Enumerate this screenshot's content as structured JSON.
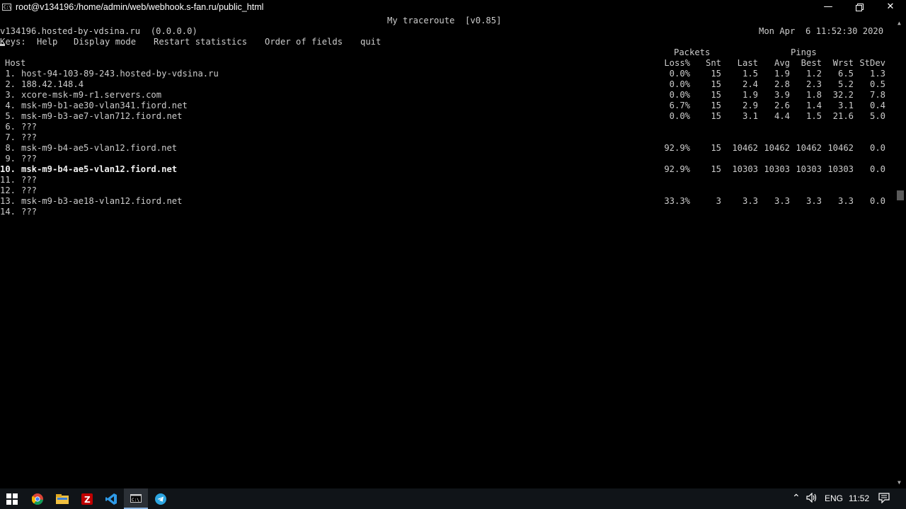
{
  "window": {
    "title": "root@v134196:/home/admin/web/webhook.s-fan.ru/public_html",
    "icon_glyph": "C:\\",
    "controls": [
      "minimize-icon",
      "restore-icon",
      "close-icon"
    ]
  },
  "terminal": {
    "app_title": "My traceroute  [v0.85]",
    "host_line": "v134196.hosted-by-vdsina.ru  (0.0.0.0)",
    "datetime": "Mon Apr  6 11:52:30 2020",
    "keys_label": "Keys:",
    "keys": [
      "Help",
      "Display mode",
      "Restart statistics",
      "Order of fields",
      "quit"
    ],
    "group_headers": {
      "packets": "Packets",
      "pings": "Pings"
    },
    "columns": {
      "host": "Host",
      "loss": "Loss%",
      "snt": "Snt",
      "last": "Last",
      "avg": "Avg",
      "best": "Best",
      "wrst": "Wrst",
      "stdev": "StDev"
    },
    "hops": [
      {
        "n": " 1.",
        "host": "host-94-103-89-243.hosted-by-vdsina.ru",
        "loss": "0.0%",
        "snt": "15",
        "last": "1.5",
        "avg": "1.9",
        "best": "1.2",
        "wrst": "6.5",
        "stdev": "1.3"
      },
      {
        "n": " 2.",
        "host": "188.42.148.4",
        "loss": "0.0%",
        "snt": "15",
        "last": "2.4",
        "avg": "2.8",
        "best": "2.3",
        "wrst": "5.2",
        "stdev": "0.5"
      },
      {
        "n": " 3.",
        "host": "xcore-msk-m9-r1.servers.com",
        "loss": "0.0%",
        "snt": "15",
        "last": "1.9",
        "avg": "3.9",
        "best": "1.8",
        "wrst": "32.2",
        "stdev": "7.8"
      },
      {
        "n": " 4.",
        "host": "msk-m9-b1-ae30-vlan341.fiord.net",
        "loss": "6.7%",
        "snt": "15",
        "last": "2.9",
        "avg": "2.6",
        "best": "1.4",
        "wrst": "3.1",
        "stdev": "0.4"
      },
      {
        "n": " 5.",
        "host": "msk-m9-b3-ae7-vlan712.fiord.net",
        "loss": "0.0%",
        "snt": "15",
        "last": "3.1",
        "avg": "4.4",
        "best": "1.5",
        "wrst": "21.6",
        "stdev": "5.0"
      },
      {
        "n": " 6.",
        "host": "???"
      },
      {
        "n": " 7.",
        "host": "???"
      },
      {
        "n": " 8.",
        "host": "msk-m9-b4-ae5-vlan12.fiord.net",
        "loss": "92.9%",
        "snt": "15",
        "last": "10462",
        "avg": "10462",
        "best": "10462",
        "wrst": "10462",
        "stdev": "0.0"
      },
      {
        "n": " 9.",
        "host": "???"
      },
      {
        "n": "10.",
        "host": "msk-m9-b4-ae5-vlan12.fiord.net",
        "loss": "92.9%",
        "snt": "15",
        "last": "10303",
        "avg": "10303",
        "best": "10303",
        "wrst": "10303",
        "stdev": "0.0",
        "highlight": true
      },
      {
        "n": "11.",
        "host": "???"
      },
      {
        "n": "12.",
        "host": "???"
      },
      {
        "n": "13.",
        "host": "msk-m9-b3-ae18-vlan12.fiord.net",
        "loss": "33.3%",
        "snt": "3",
        "last": "3.3",
        "avg": "3.3",
        "best": "3.3",
        "wrst": "3.3",
        "stdev": "0.0"
      },
      {
        "n": "14.",
        "host": "???"
      }
    ]
  },
  "taskbar": {
    "apps": [
      "windows-start-icon",
      "chrome-icon",
      "file-explorer-icon",
      "filezilla-icon",
      "vscode-icon",
      "terminal-icon",
      "telegram-icon"
    ],
    "active_app": "terminal-icon",
    "language": "ENG",
    "clock": "11:52",
    "tray_icons": [
      "chevron-up-icon",
      "volume-icon",
      "notification-icon"
    ],
    "colors": {
      "taskbar_bg": "#101418",
      "terminal_bg": "#000000",
      "terminal_fg": "#cccccc"
    }
  }
}
